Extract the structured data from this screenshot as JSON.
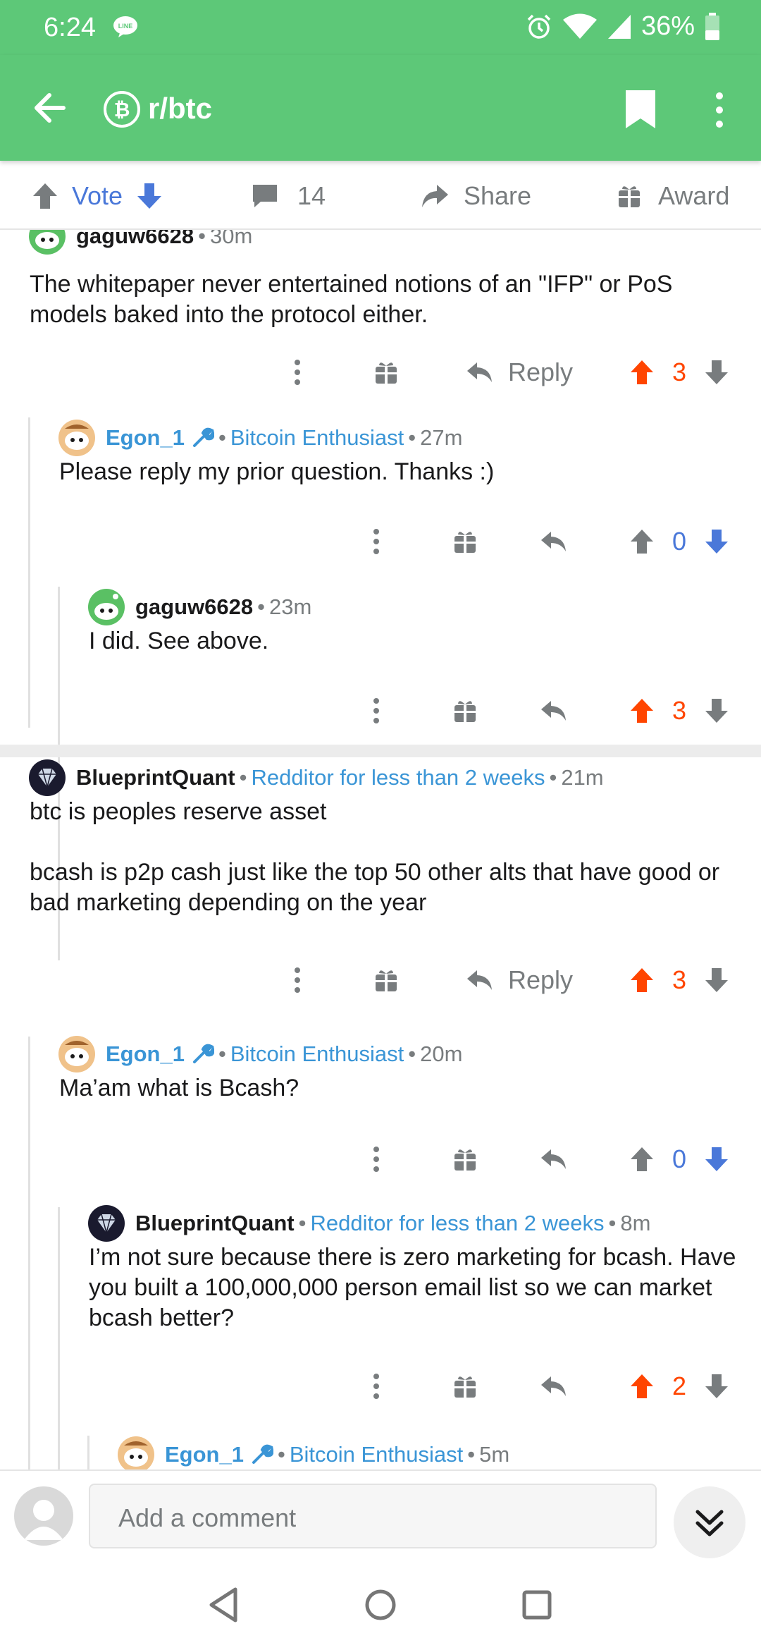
{
  "status_bar": {
    "time": "6:24",
    "battery": "36%",
    "notification_icon": "line-app-icon",
    "icons": [
      "alarm-icon",
      "wifi-icon",
      "signal-icon",
      "battery-icon"
    ]
  },
  "header": {
    "subreddit": "r/btc",
    "subreddit_icon": "bitcoin-icon",
    "color": "#5dc878"
  },
  "post_actions": {
    "vote_label": "Vote",
    "comment_count": "14",
    "share_label": "Share",
    "award_label": "Award"
  },
  "comments": [
    {
      "username": "gaguw6628",
      "flair": "",
      "time": "30m",
      "body": "The whitepaper never entertained notions of an \"IFP\" or PoS models baked into the protocol either.",
      "reply_label": "Reply",
      "score": "3",
      "vote_state": "up"
    },
    {
      "username": "Egon_1",
      "flair": "Bitcoin Enthusiast",
      "time": "27m",
      "body": "Please reply my prior question. Thanks :)",
      "score": "0",
      "vote_state": "down"
    },
    {
      "username": "gaguw6628",
      "flair": "",
      "time": "23m",
      "body": "I did. See above.",
      "score": "3",
      "vote_state": "up"
    },
    {
      "username": "BlueprintQuant",
      "flair": "Redditor for less than 2 weeks",
      "time": "21m",
      "body": "btc is peoples reserve asset\n\nbcash is p2p cash just like the top 50 other alts that have good or bad marketing depending on the year",
      "reply_label": "Reply",
      "score": "3",
      "vote_state": "up"
    },
    {
      "username": "Egon_1",
      "flair": "Bitcoin Enthusiast",
      "time": "20m",
      "body": "Ma’am what is Bcash?",
      "score": "0",
      "vote_state": "down"
    },
    {
      "username": "BlueprintQuant",
      "flair": "Redditor for less than 2 weeks",
      "time": "8m",
      "body": "I’m not sure because there is zero marketing for bcash. Have you built a 100,000,000 person email list so we can market bcash better?",
      "score": "2",
      "vote_state": "up"
    },
    {
      "username": "Egon_1",
      "flair": "Bitcoin Enthusiast",
      "time": "5m",
      "body": "",
      "score": "",
      "vote_state": "none"
    }
  ],
  "comment_input": {
    "placeholder": "Add a comment"
  },
  "colors": {
    "upvote": "#ff4500",
    "downvote": "#4a78d9",
    "flair": "#3a95d6",
    "muted": "#787c7e"
  }
}
